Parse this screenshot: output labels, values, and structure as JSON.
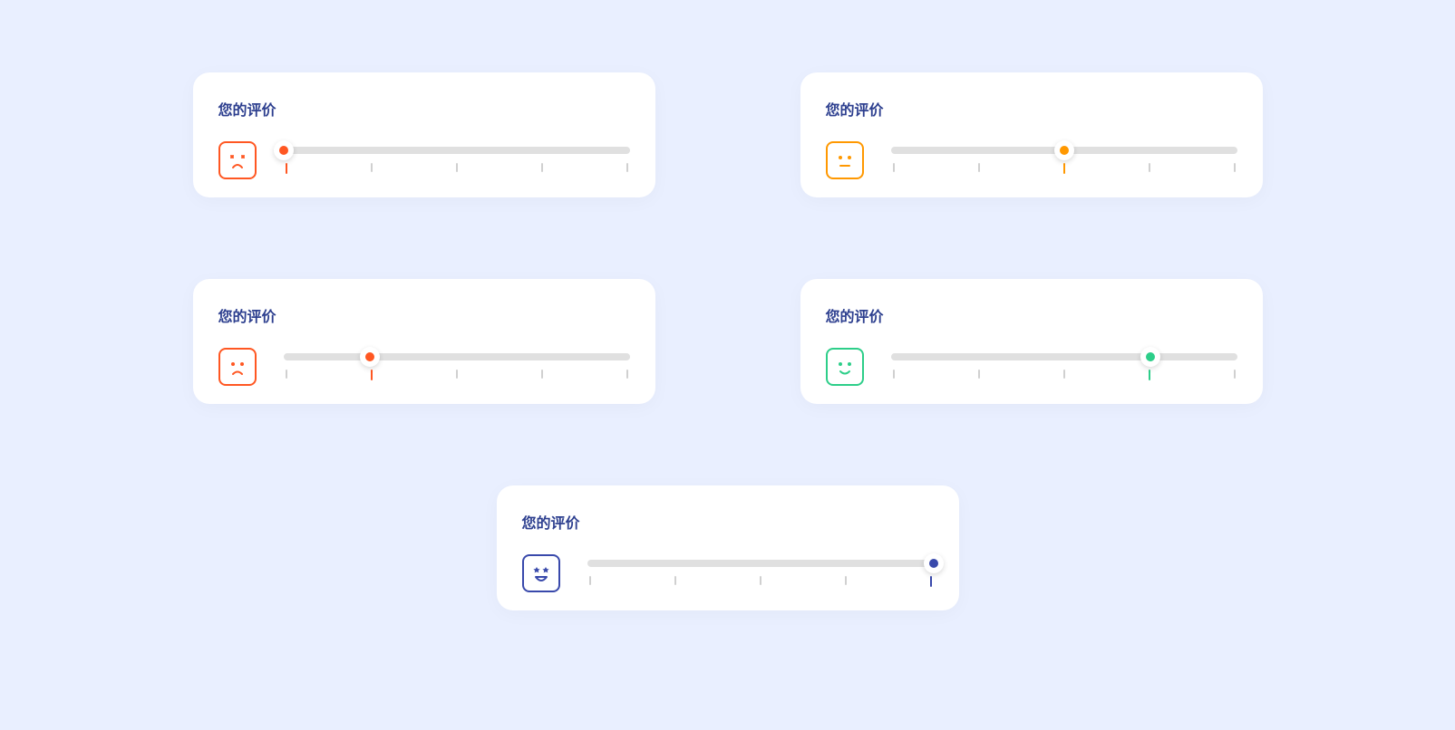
{
  "title": "您的评价",
  "sliders": [
    {
      "value": 1,
      "color": "#ff5722",
      "emoji": "sad",
      "colorIndex": 0
    },
    {
      "value": 3,
      "color": "#ff9800",
      "emoji": "neutral",
      "colorIndex": 2
    },
    {
      "value": 2,
      "color": "#ff5722",
      "emoji": "frown",
      "colorIndex": 1
    },
    {
      "value": 4,
      "color": "#2dce89",
      "emoji": "smile",
      "colorIndex": 3
    },
    {
      "value": 5,
      "color": "#3949ab",
      "emoji": "grin",
      "colorIndex": 4
    }
  ],
  "max": 5
}
